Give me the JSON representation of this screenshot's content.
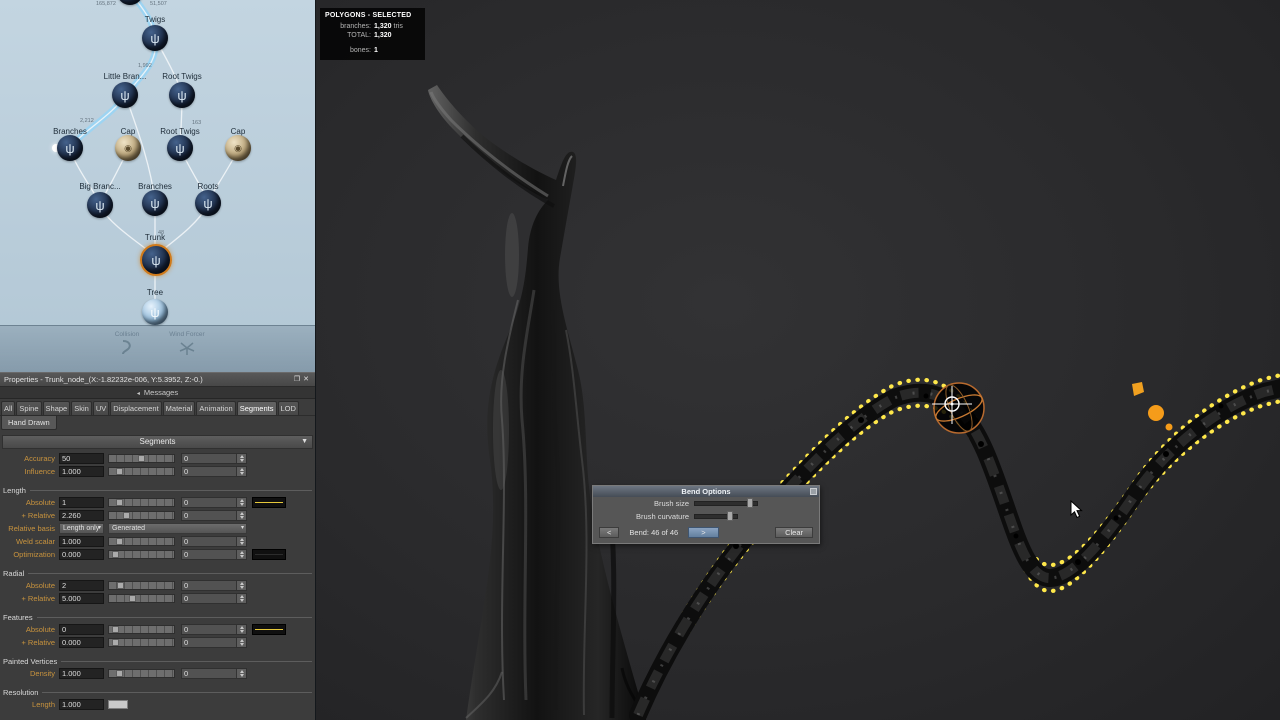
{
  "node_graph": {
    "stat_left": "165,872",
    "stat_right": "51,507",
    "edge_stats": {
      "twigs": "1,992",
      "branches": "2,212",
      "roots": "163",
      "trunk": "48"
    },
    "nodes": {
      "twigs": {
        "label": "Twigs"
      },
      "little_branches": {
        "label": "Little Bran..."
      },
      "root_twigs_upper": {
        "label": "Root Twigs"
      },
      "branches_left": {
        "label": "Branches"
      },
      "cap_left": {
        "label": "Cap"
      },
      "root_twigs_lower": {
        "label": "Root Twigs"
      },
      "cap_right": {
        "label": "Cap"
      },
      "big_branches": {
        "label": "Big Branc..."
      },
      "branches_mid": {
        "label": "Branches"
      },
      "roots": {
        "label": "Roots"
      },
      "trunk": {
        "label": "Trunk"
      },
      "tree": {
        "label": "Tree"
      }
    },
    "forces": {
      "collision": "Collision",
      "wind": "Wind Forcer"
    }
  },
  "overlay": {
    "title": "POLYGONS - SELECTED",
    "branches_label": "branches:",
    "branches_value": "1,320",
    "branches_suffix": "tris",
    "total_label": "TOTAL:",
    "total_value": "1,320",
    "bones_label": "bones:",
    "bones_value": "1"
  },
  "properties": {
    "title": "Properties - Trunk_node_(X:-1.82232e-006, Y:5.3952, Z:-0.)",
    "messages": "Messages",
    "tabs": {
      "all": "All",
      "spine": "Spine",
      "shape": "Shape",
      "skin": "Skin",
      "uv": "UV",
      "displacement": "Displacement",
      "material": "Material",
      "animation": "Animation",
      "segments": "Segments",
      "lod": "LOD"
    },
    "subtab": "Hand Drawn",
    "section": "Segments",
    "groups": {
      "length": "Length",
      "radial": "Radial",
      "features": "Features",
      "painted": "Painted Vertices",
      "resolution": "Resolution"
    },
    "rows": {
      "accuracy": {
        "label": "Accuracy",
        "value": "50",
        "spin": "0"
      },
      "influence": {
        "label": "Influence",
        "value": "1.000",
        "spin": "0"
      },
      "length_absolute": {
        "label": "Absolute",
        "value": "1",
        "spin": "0"
      },
      "length_relative": {
        "label": "+ Relative",
        "value": "2.260",
        "spin": "0"
      },
      "relative_basis": {
        "label": "Relative basis",
        "value": "Length only",
        "mode": "Generated"
      },
      "weld_scalar": {
        "label": "Weld scalar",
        "value": "1.000",
        "spin": "0"
      },
      "optimization": {
        "label": "Optimization",
        "value": "0.000",
        "spin": "0"
      },
      "radial_absolute": {
        "label": "Absolute",
        "value": "2",
        "spin": "0"
      },
      "radial_relative": {
        "label": "+ Relative",
        "value": "5.000",
        "spin": "0"
      },
      "features_absolute": {
        "label": "Absolute",
        "value": "0",
        "spin": "0"
      },
      "features_relative": {
        "label": "+ Relative",
        "value": "0.000",
        "spin": "0"
      },
      "density": {
        "label": "Density",
        "value": "1.000",
        "spin": "0"
      },
      "res_length": {
        "label": "Length",
        "value": "1.000"
      }
    }
  },
  "bend": {
    "title": "Bend Options",
    "brush_size": "Brush size",
    "brush_curvature": "Brush curvature",
    "prev": "<",
    "status": "Bend: 46 of 46",
    "next": ">",
    "clear": "Clear"
  },
  "colors": {
    "selection_yellow": "#ffe84a",
    "gizmo_orange": "#f59c1a",
    "accent_blue": "#9bd4f2",
    "label_orange": "#c8933e"
  }
}
